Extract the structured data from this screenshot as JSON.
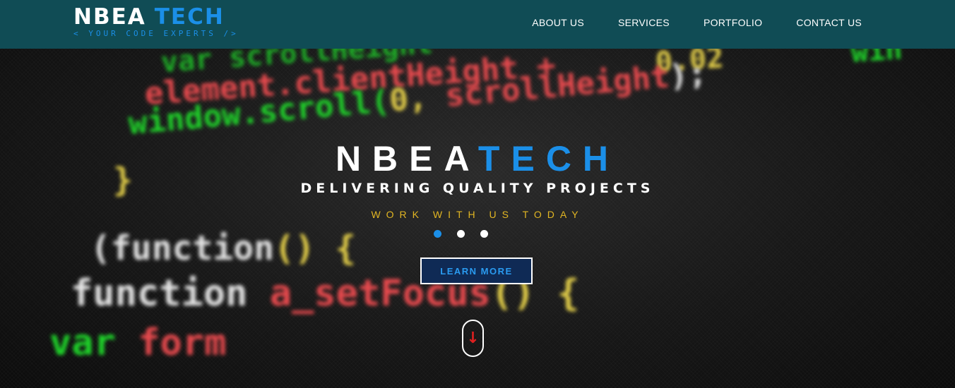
{
  "brand": {
    "name_part1": "NBEA",
    "name_part2": "TECH",
    "tagline": "< YOUR CODE EXPERTS />"
  },
  "nav": {
    "items": [
      {
        "label": "ABOUT US"
      },
      {
        "label": "SERVICES"
      },
      {
        "label": "PORTFOLIO"
      },
      {
        "label": "CONTACT US"
      }
    ]
  },
  "hero": {
    "title_part1": "NBEA",
    "title_part2": "TECH",
    "subtitle": "DELIVERING QUALITY PROJECTS",
    "call_to_action": "WORK WITH US TODAY",
    "learn_more_label": "LEARN MORE",
    "scroll_icon": "down-arrow-icon",
    "carousel": {
      "count": 3,
      "active_index": 0
    },
    "background_code": {
      "line1": [
        "var scrollHeight",
        "0.02",
        "win"
      ],
      "line2": "element.clientHeight + ",
      "line3_a": "window.scroll(",
      "line3_b": "0, ",
      "line3_c": "scrollHeight",
      "line3_d": ");",
      "line4": "}",
      "line5_a": "(function",
      "line5_b": "() {",
      "line6_a": "function",
      "line6_b": "a_setFocus",
      "line6_c": "() {",
      "line7_a": "var",
      "line7_b": "form"
    }
  },
  "colors": {
    "nav_background": "#104c55",
    "accent_blue": "#1b8fe8",
    "accent_gold": "#e2b623",
    "button_background": "#0f2a55",
    "scroll_arrow": "#e02020"
  }
}
